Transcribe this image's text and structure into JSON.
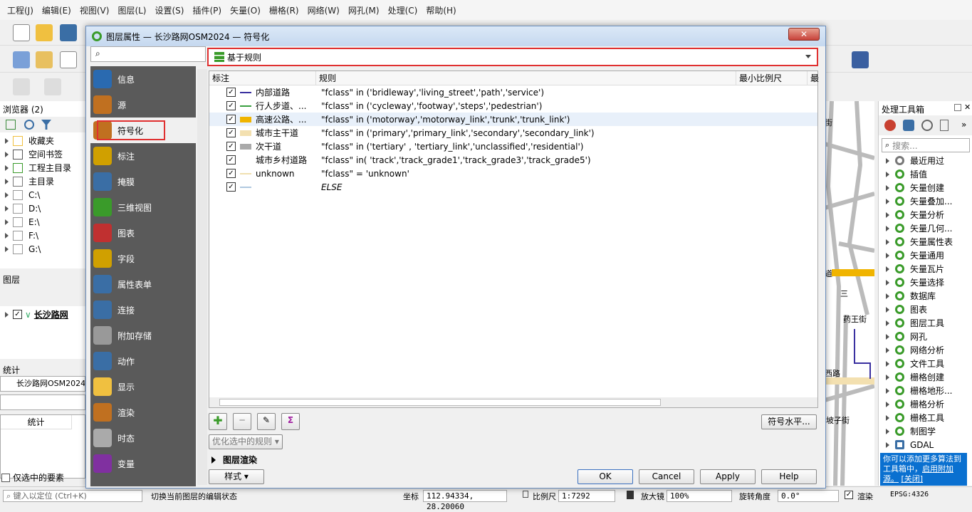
{
  "menu": [
    "工程(J)",
    "编辑(E)",
    "视图(V)",
    "图层(L)",
    "设置(S)",
    "插件(P)",
    "矢量(O)",
    "栅格(R)",
    "网络(W)",
    "网孔(M)",
    "处理(C)",
    "帮助(H)"
  ],
  "browser": {
    "title": "浏览器 (2)",
    "items": [
      "收藏夹",
      "空间书签",
      "工程主目录",
      "主目录",
      "C:\\",
      "D:\\",
      "E:\\",
      "F:\\",
      "G:\\"
    ]
  },
  "layers": {
    "title": "图层",
    "layer_name": "长沙路网"
  },
  "stats": {
    "title": "统计",
    "layer": "长沙路网OSM2024",
    "col_header": "统计",
    "selected_only": "仅选中的要素"
  },
  "dialog": {
    "title": "图层属性 — 长沙路网OSM2024 — 符号化",
    "close": "✕",
    "renderer": "基于规则",
    "sidebar": [
      "信息",
      "源",
      "符号化",
      "标注",
      "掩膜",
      "三维视图",
      "图表",
      "字段",
      "属性表单",
      "连接",
      "附加存储",
      "动作",
      "显示",
      "渲染",
      "时态",
      "变量"
    ],
    "columns": {
      "label": "标注",
      "rule": "规则",
      "min_scale": "最小比例尺",
      "max_scale": "最"
    },
    "rules": [
      {
        "label": "内部道路",
        "rule": "\"fclass\" in ('bridleway','living_street','path','service')",
        "color": "#3a30a0",
        "type": "line"
      },
      {
        "label": "行人步道、...",
        "rule": "\"fclass\" in ('cycleway','footway','steps','pedestrian')",
        "color": "#3aa040",
        "type": "line"
      },
      {
        "label": "高速公路、...",
        "rule": "\"fclass\" in ('motorway','motorway_link','trunk','trunk_link')",
        "color": "#f0b400",
        "type": "fill"
      },
      {
        "label": "城市主干道",
        "rule": "\"fclass\" in ('primary','primary_link','secondary','secondary_link')",
        "color": "#f3e0b0",
        "type": "fill"
      },
      {
        "label": "次干道",
        "rule": "\"fclass\" in ('tertiary' , 'tertiary_link','unclassified','residential')",
        "color": "#aaaaaa",
        "type": "fill"
      },
      {
        "label": "城市乡村道路",
        "rule": "\"fclass\" in( 'track','track_grade1','track_grade3','track_grade5')",
        "color": "",
        "type": "none"
      },
      {
        "label": "unknown",
        "rule": "\"fclass\" = 'unknown'",
        "color": "#f0e0b0",
        "type": "line"
      },
      {
        "label": "",
        "rule": "ELSE",
        "color": "#b0c8e0",
        "type": "line"
      }
    ],
    "refine": "优化选中的规则",
    "symbol_levels": "符号水平...",
    "layer_rendering": "图层渲染",
    "style": "样式",
    "ok": "OK",
    "cancel": "Cancel",
    "apply": "Apply",
    "help": "Help"
  },
  "toolbox": {
    "title": "处理工具箱",
    "search_placeholder": "搜索...",
    "items": [
      "最近用过",
      "插值",
      "矢量创建",
      "矢量叠加...",
      "矢量分析",
      "矢量几何...",
      "矢量属性表",
      "矢量通用",
      "矢量瓦片",
      "矢量选择",
      "数据库",
      "图表",
      "图层工具",
      "网孔",
      "网络分析",
      "文件工具",
      "栅格创建",
      "栅格地形...",
      "栅格分析",
      "栅格工具",
      "制图学",
      "GDAL"
    ],
    "note": "你可以添加更多算法到工具箱中，",
    "note_link": "启用附加源。",
    "note_close": "[关闭]"
  },
  "map_labels": [
    "道",
    "三",
    "药王街",
    "三兴街",
    "西路",
    "坡子街",
    "街"
  ],
  "status": {
    "locate_placeholder": "键入以定位 (Ctrl+K)",
    "message": "切换当前图层的编辑状态",
    "coord_label": "坐标",
    "coord": "112.94334, 28.20060",
    "scale_label": "比例尺",
    "scale": "1:7292",
    "magnifier_label": "放大镜",
    "magnifier": "100%",
    "rotation_label": "旋转角度",
    "rotation": "0.0°",
    "render": "渲染",
    "crs": "EPSG:4326"
  }
}
